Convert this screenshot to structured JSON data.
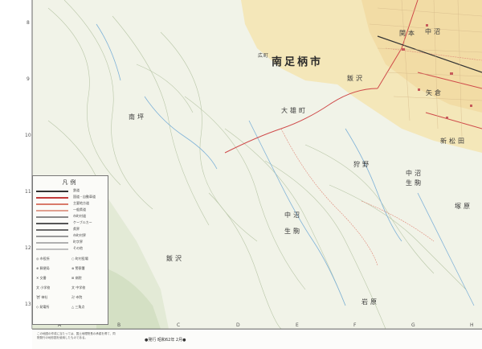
{
  "map": {
    "city_label": "南足柄市",
    "places": {
      "hirocho": "広町",
      "kokuzawa": "飯沢",
      "daiyucho": "大雄町",
      "minamihira": "南坪",
      "kariyano": "狩野",
      "nakanuma_label": "中沼",
      "ikoma_1": "生駒",
      "nakanuma_2": "中沼",
      "ikoma_2": "生駒",
      "tsukahara": "塚原",
      "iizawa": "飯沢",
      "sekimoto": "関本",
      "nakanuma_top": "中沼",
      "yagura": "矢倉",
      "iwahara": "岩原",
      "shinmatsuda": "新松田"
    },
    "grid_letters": [
      "A",
      "B",
      "C",
      "D",
      "E",
      "F",
      "G",
      "H"
    ],
    "grid_numbers": [
      "8",
      "9",
      "10",
      "11",
      "12",
      "13"
    ]
  },
  "legend": {
    "title": "凡例",
    "rows": [
      {
        "label": "鉄道",
        "color": "#333333"
      },
      {
        "label": "国道・自動車道",
        "color": "#c23a3a"
      },
      {
        "label": "主要地方道",
        "color": "#d97a6a"
      },
      {
        "label": "一般県道",
        "color": "#e0a090"
      },
      {
        "label": "市町村道",
        "color": "#888888"
      },
      {
        "label": "ケーブルカー",
        "color": "#555555"
      },
      {
        "label": "県界",
        "color": "#6a6a6a"
      },
      {
        "label": "市町村界",
        "color": "#9a9a9a"
      },
      {
        "label": "町字界",
        "color": "#b0b0b0"
      },
      {
        "label": "その他",
        "color": "#c0c0c0"
      }
    ],
    "symbols": [
      "◎ 市役所",
      "○ 町村役場",
      "⊕ 郵便局",
      "⊗ 警察署",
      "✕ 交番",
      "⊞ 病院",
      "文 小学校",
      "文 中学校",
      "⛩ 神社",
      "卍 寺院",
      "◇ 発電所",
      "△ 三角点"
    ]
  },
  "footer": {
    "note": "この地図の作成に当たっては、国土地理院長の承認を得て、同院発行の地形図を使用したものである。",
    "code": "●発行 昭和62年 2月●"
  }
}
